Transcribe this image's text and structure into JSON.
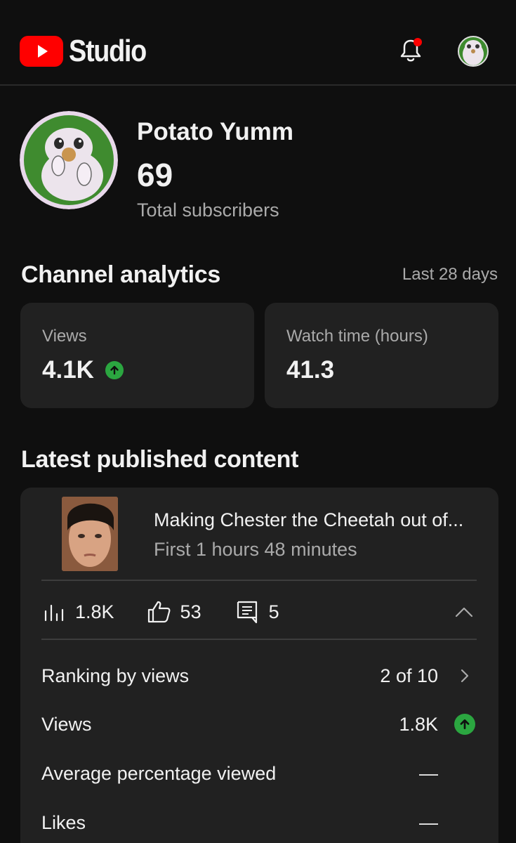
{
  "header": {
    "logo_text": "Studio",
    "notification_dot_color": "#ff0000"
  },
  "channel": {
    "name": "Potato Yumm",
    "subscribers": "69",
    "subscribers_label": "Total subscribers"
  },
  "analytics": {
    "title": "Channel analytics",
    "period": "Last 28 days",
    "cards": [
      {
        "label": "Views",
        "value": "4.1K",
        "trend": "up"
      },
      {
        "label": "Watch time (hours)",
        "value": "41.3"
      }
    ]
  },
  "latest": {
    "title": "Latest published content",
    "video": {
      "title": "Making Chester the Cheetah out of...",
      "subtitle": "First 1 hours 48 minutes"
    },
    "metrics": {
      "views": "1.8K",
      "likes": "53",
      "comments": "5"
    },
    "details": [
      {
        "label": "Ranking by views",
        "value": "2 of 10",
        "icon": "chevron-right-icon"
      },
      {
        "label": "Views",
        "value": "1.8K",
        "icon": "trend-up-icon"
      },
      {
        "label": "Average percentage viewed",
        "value": "—"
      },
      {
        "label": "Likes",
        "value": "—"
      }
    ]
  },
  "colors": {
    "background": "#0f0f0f",
    "card": "#212121",
    "brand_red": "#ff0000",
    "trend_green": "#2ba640",
    "secondary_text": "#aaaaaa"
  }
}
